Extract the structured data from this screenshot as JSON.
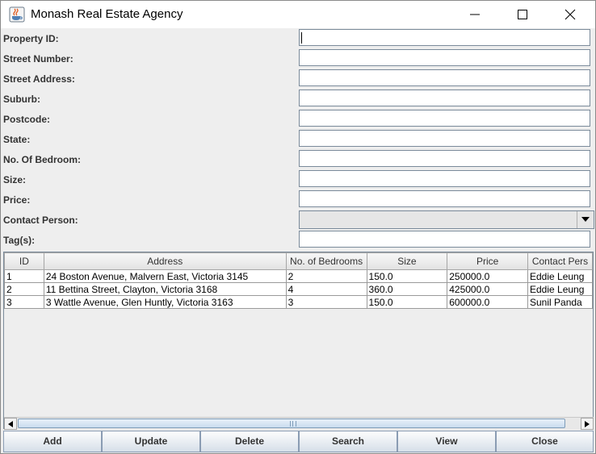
{
  "window": {
    "title": "Monash Real Estate Agency",
    "icon": "java-coffee-icon"
  },
  "form": {
    "fields": [
      {
        "label": "Property ID:",
        "value": ""
      },
      {
        "label": "Street Number:",
        "value": ""
      },
      {
        "label": "Street Address:",
        "value": ""
      },
      {
        "label": "Suburb:",
        "value": ""
      },
      {
        "label": "Postcode:",
        "value": ""
      },
      {
        "label": "State:",
        "value": ""
      },
      {
        "label": "No. Of Bedroom:",
        "value": ""
      },
      {
        "label": "Size:",
        "value": ""
      },
      {
        "label": "Price:",
        "value": ""
      },
      {
        "label": "Contact Person:",
        "value": ""
      },
      {
        "label": "Tag(s):",
        "value": ""
      }
    ]
  },
  "table": {
    "headers": [
      "ID",
      "Address",
      "No. of Bedrooms",
      "Size",
      "Price",
      "Contact Pers"
    ],
    "rows": [
      [
        "1",
        "24 Boston Avenue, Malvern East, Victoria 3145",
        "2",
        "150.0",
        "250000.0",
        "Eddie Leung"
      ],
      [
        "2",
        "11 Bettina Street, Clayton, Victoria 3168",
        "4",
        "360.0",
        "425000.0",
        "Eddie Leung"
      ],
      [
        "3",
        "3 Wattle Avenue, Glen Huntly, Victoria 3163",
        "3",
        "150.0",
        "600000.0",
        "Sunil Panda"
      ]
    ]
  },
  "buttons": {
    "add": "Add",
    "update": "Update",
    "delete": "Delete",
    "search": "Search",
    "view": "View",
    "close": "Close"
  },
  "colors": {
    "panel": "#eeeeee",
    "border": "#7a8a9a",
    "button_top": "#fdfdfd",
    "button_bottom": "#d6dfe9"
  }
}
